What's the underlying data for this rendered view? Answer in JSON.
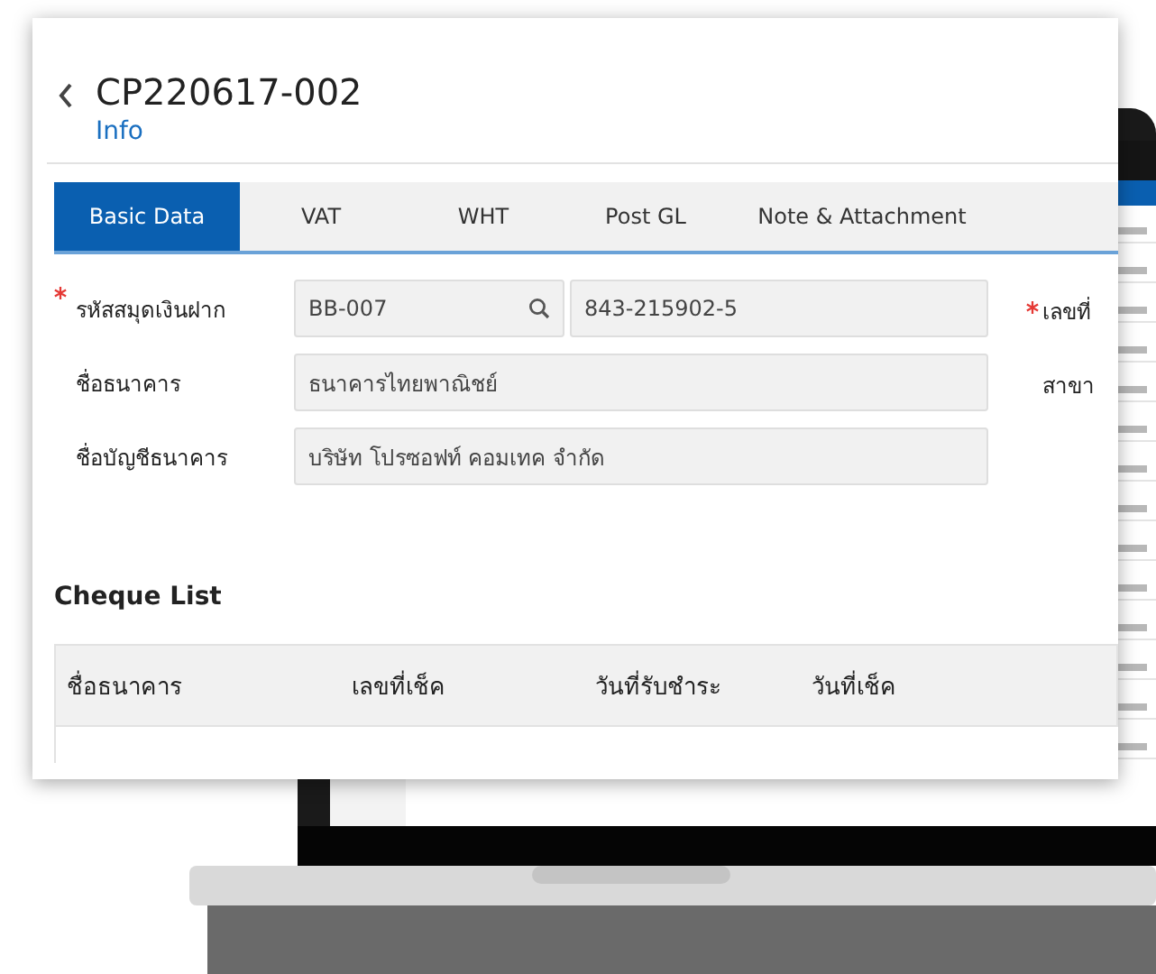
{
  "header": {
    "title": "CP220617-002",
    "subtitle": "Info"
  },
  "tabs": [
    {
      "label": "Basic Data",
      "selected": true
    },
    {
      "label": "VAT",
      "selected": false
    },
    {
      "label": "WHT",
      "selected": false
    },
    {
      "label": "Post GL",
      "selected": false
    },
    {
      "label": "Note & Attachment",
      "selected": false
    }
  ],
  "fields": [
    {
      "label": "รหัสสมุดเงินฝาก",
      "required": true,
      "inputs": [
        {
          "value": "BB-007",
          "lookup": true
        },
        {
          "value": "843-215902-5",
          "lookup": false
        }
      ]
    },
    {
      "label": "ชื่อธนาคาร",
      "required": false,
      "inputs": [
        {
          "value": "ธนาคารไทยพาณิชย์",
          "lookup": false
        }
      ]
    },
    {
      "label": "ชื่อบัญชีธนาคาร",
      "required": false,
      "inputs": [
        {
          "value": "บริษัท โปรซอฟท์ คอมเทค จำกัด",
          "lookup": false
        }
      ]
    }
  ],
  "side_fields": [
    {
      "label": "เลขที่",
      "required": true
    },
    {
      "label": "สาขา",
      "required": false
    }
  ],
  "cheque_list": {
    "title": "Cheque List",
    "columns": [
      "ชื่อธนาคาร",
      "เลขที่เช็ค",
      "วันที่รับชำระ",
      "วันที่เช็ค"
    ]
  }
}
